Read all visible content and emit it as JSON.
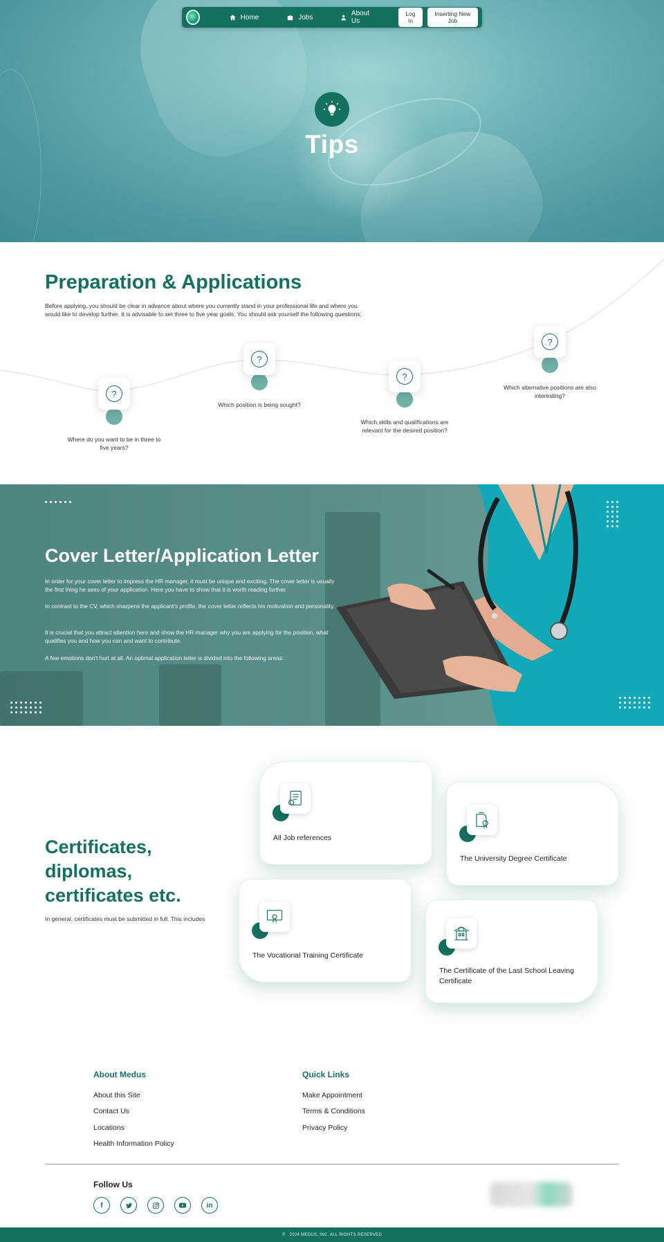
{
  "nav": {
    "home": "Home",
    "jobs": "Jobs",
    "about": "About Us",
    "login": "Log In",
    "insert_job": "Inserting New Job"
  },
  "hero": {
    "title": "Tips"
  },
  "preparation": {
    "title": "Preparation & Applications",
    "intro": "Before applying, you should be clear in advance about where you currently stand in your professional life and where you would like to develop further. It is advisable to set three to five year goals. You should ask yourself the following questions:",
    "questions": [
      "Where do you want to be in three to five years?",
      "Which position is being sought?",
      "Which skills and qualifications are relevant for the desired position?",
      "Which alternative positions are also interesting?"
    ]
  },
  "cover": {
    "title": "Cover Letter/Application Letter",
    "paragraphs": [
      "In order for your cover letter to impress the HR manager, it must be unique and exciting. The cover letter is usually the first thing he sees of your application. Here you have to show that it is worth reading further.",
      "In contrast to the CV, which sharpens the applicant's profile, the cover letter reflects his motivation and personality.",
      "It is crucial that you attract attention here and show the HR manager why you are applying for the position, what qualifies you and how you can and want to contribute.",
      "A few emotions don't hurt at all. An optimal application letter is divided into the following areas:"
    ]
  },
  "certificates": {
    "title": "Certificates, diplomas, certificates etc.",
    "intro": "In general, certificates must be submitted in full. This includes",
    "items": [
      "All Job references",
      "The University Degree Certificate",
      "The Vocational Training Certificate",
      "The Certificate of the Last School Leaving Certificate"
    ]
  },
  "footer": {
    "about_heading": "About Medus",
    "about_links": [
      "About this Site",
      "Contact Us",
      "Locations",
      "Health Information Policy"
    ],
    "quick_heading": "Quick Links",
    "quick_links": [
      "Make Appointment",
      "Terms & Conditions",
      "Privacy Policy"
    ],
    "follow_heading": "Follow Us",
    "social": [
      "facebook-icon",
      "twitter-icon",
      "instagram-icon",
      "youtube-icon",
      "linkedin-icon"
    ],
    "copyright": "2024 MEDUS, INC. ALL RIGHTS RESERVED"
  },
  "colors": {
    "brand": "#14705f",
    "accent_dot": "#6fb0a8",
    "hero_bg": "#6fb4b7"
  }
}
